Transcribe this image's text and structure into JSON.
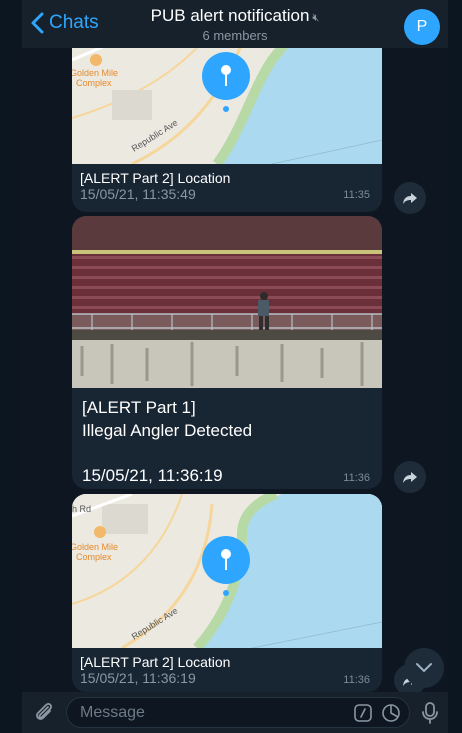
{
  "header": {
    "back_label": "Chats",
    "title": "PUB alert notification",
    "subtitle": "6 members",
    "avatar_letter": "P"
  },
  "messages": [
    {
      "type": "location",
      "map_labels": [
        "Golden Mile",
        "Complex",
        "Republic Ave"
      ],
      "title": "[ALERT Part 2] Location",
      "date": "15/05/21, 11:35:49",
      "time": "11:35"
    },
    {
      "type": "photo",
      "line1": "[ALERT Part 1]",
      "line2": "Illegal Angler Detected",
      "date": "15/05/21, 11:36:19",
      "time": "11:36"
    },
    {
      "type": "location",
      "map_labels": [
        "h Rd",
        "Golden Mile",
        "Complex",
        "Republic Ave"
      ],
      "title": "[ALERT Part 2] Location",
      "date": "15/05/21, 11:36:19",
      "time": "11:36"
    }
  ],
  "composer": {
    "placeholder": "Message"
  },
  "colors": {
    "accent": "#2ea6ff",
    "bubble": "#182533",
    "background": "#0e1621",
    "bar": "#17212b"
  }
}
